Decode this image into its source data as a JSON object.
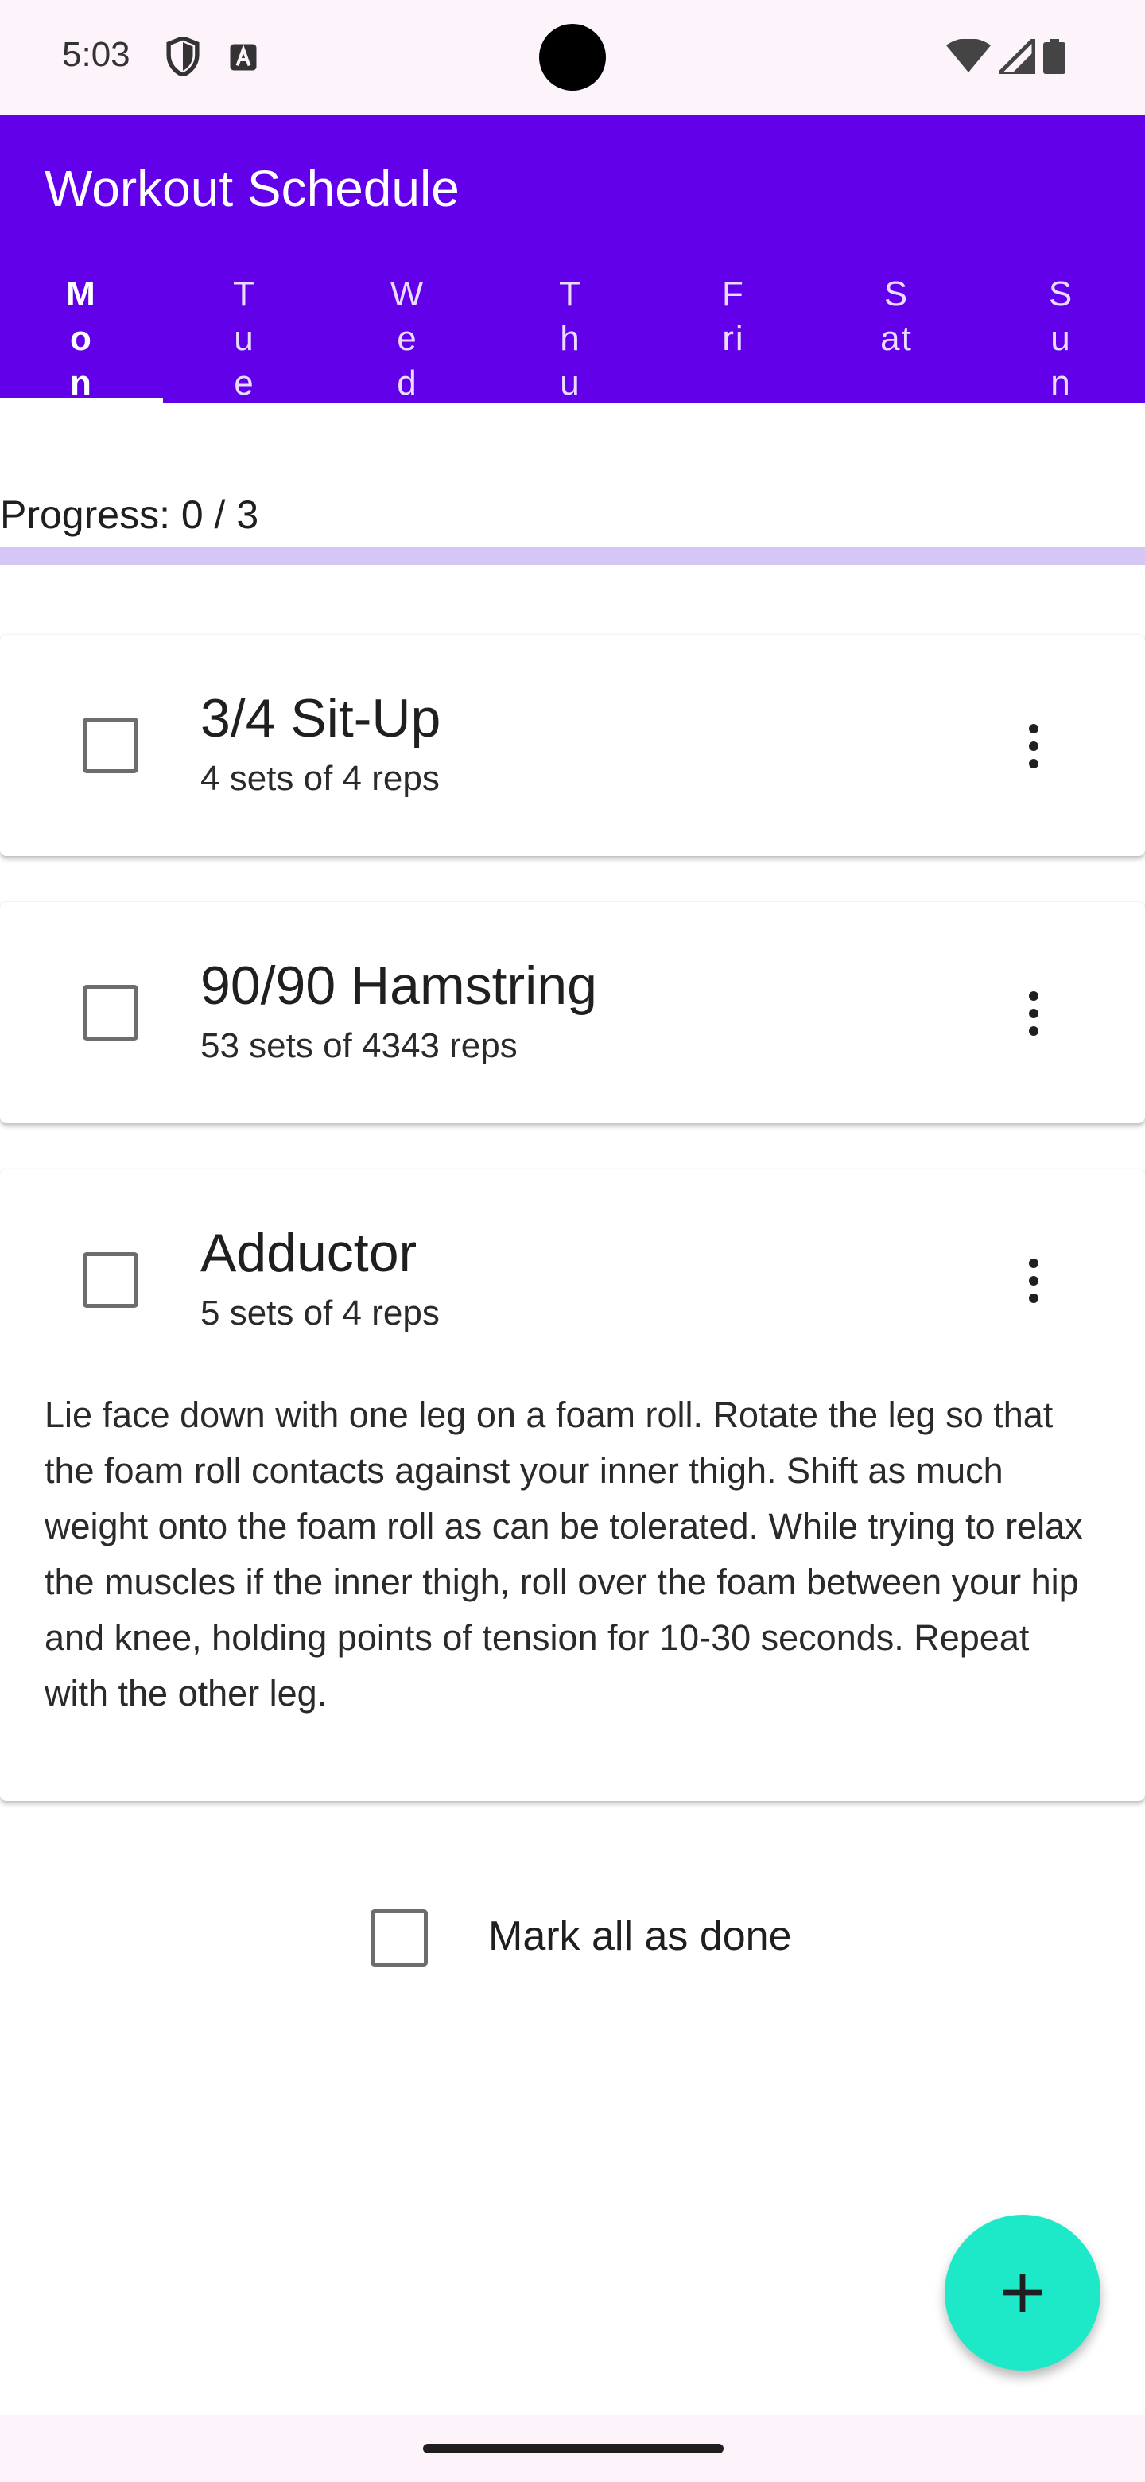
{
  "status_bar": {
    "time": "5:03"
  },
  "app_bar": {
    "title": "Workout Schedule",
    "background_color": "#6200ea"
  },
  "tabs": [
    {
      "label": "Mon",
      "active": true
    },
    {
      "label": "Tue",
      "active": false
    },
    {
      "label": "Wed",
      "active": false
    },
    {
      "label": "Thu",
      "active": false
    },
    {
      "label": "Fri",
      "active": false
    },
    {
      "label": "Sat",
      "active": false
    },
    {
      "label": "Sun",
      "active": false
    }
  ],
  "progress": {
    "text": "Progress: 0 / 3",
    "completed": 0,
    "total": 3
  },
  "exercises": [
    {
      "title": "3/4 Sit-Up",
      "subtitle": "4 sets of 4 reps",
      "checked": false
    },
    {
      "title": "90/90 Hamstring",
      "subtitle": "53 sets of 4343 reps",
      "checked": false
    },
    {
      "title": "Adductor",
      "subtitle": "5 sets of 4 reps",
      "checked": false,
      "description": "Lie face down with one leg on a foam roll. Rotate the leg so that the foam roll contacts against your inner thigh. Shift as much weight onto the foam roll as can be tolerated. While trying to relax the muscles if the inner thigh, roll over the foam between your hip and knee, holding points of tension for 10-30 seconds. Repeat with the other leg."
    }
  ],
  "mark_all": {
    "label": "Mark all as done",
    "checked": false
  },
  "fab": {
    "icon": "plus-icon",
    "color": "#1de9c9"
  },
  "icons": {
    "status_left": [
      "shield-icon",
      "font-a-icon"
    ],
    "status_right": [
      "wifi-icon",
      "signal-icon",
      "battery-icon"
    ],
    "card_menu": "more-vert-icon"
  }
}
